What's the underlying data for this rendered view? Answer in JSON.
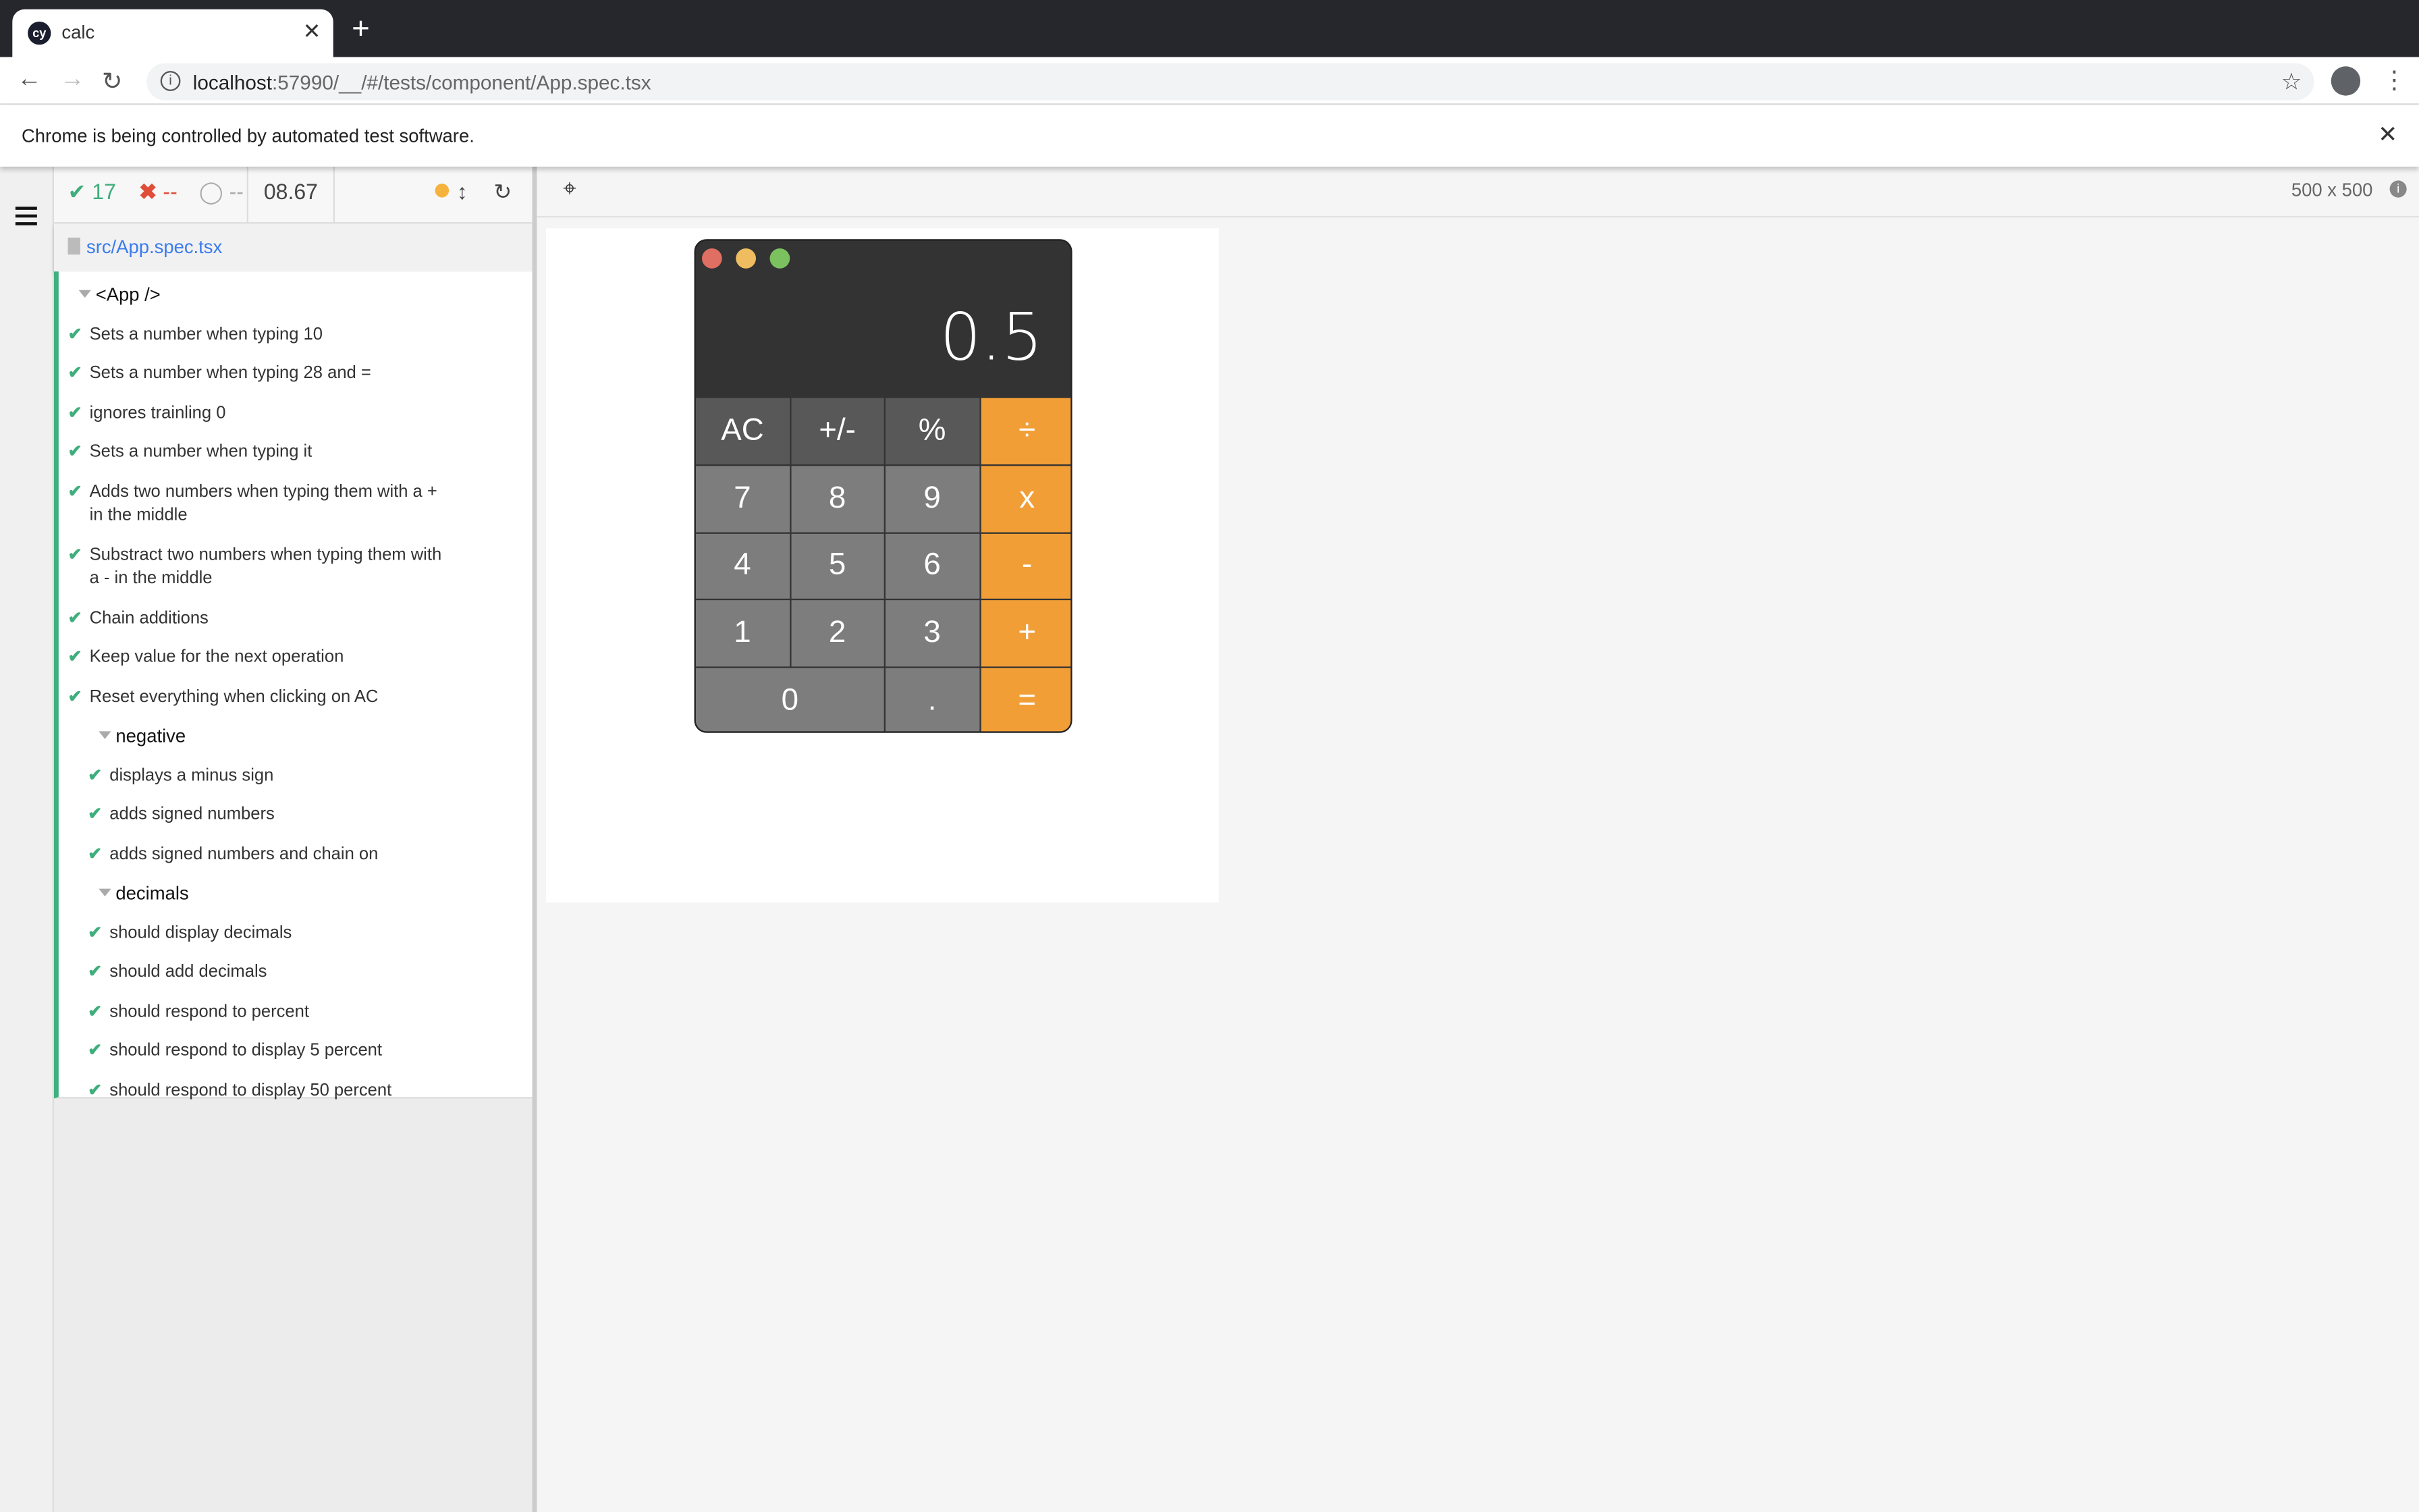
{
  "browser": {
    "tab_title": "calc",
    "favicon": "cy",
    "url_host": "localhost",
    "url_rest": ":57990/__/#/tests/component/App.spec.tsx",
    "infobar": "Chrome is being controlled by automated test software."
  },
  "reporter": {
    "passed": "17",
    "failed": "--",
    "pending": "--",
    "duration": "08.67",
    "spec_file": "src/App.spec.tsx",
    "tests": [
      {
        "type": "suite",
        "level": 0,
        "label": "<App />"
      },
      {
        "type": "test",
        "level": 1,
        "label": "Sets a number when typing 10"
      },
      {
        "type": "test",
        "level": 1,
        "label": "Sets a number when typing 28 and ="
      },
      {
        "type": "test",
        "level": 1,
        "label": "ignores trainling 0"
      },
      {
        "type": "test",
        "level": 1,
        "label": "Sets a number when typing it"
      },
      {
        "type": "test",
        "level": 1,
        "label": "Adds two numbers when typing them with a + in the middle"
      },
      {
        "type": "test",
        "level": 1,
        "label": "Substract two numbers when typing them with a - in the middle"
      },
      {
        "type": "test",
        "level": 1,
        "label": "Chain additions"
      },
      {
        "type": "test",
        "level": 1,
        "label": "Keep value for the next operation"
      },
      {
        "type": "test",
        "level": 1,
        "label": "Reset everything when clicking on AC"
      },
      {
        "type": "suite",
        "level": 1,
        "label": "negative"
      },
      {
        "type": "test",
        "level": 2,
        "label": "displays a minus sign"
      },
      {
        "type": "test",
        "level": 2,
        "label": "adds signed numbers"
      },
      {
        "type": "test",
        "level": 2,
        "label": "adds signed numbers and chain on"
      },
      {
        "type": "suite",
        "level": 1,
        "label": "decimals"
      },
      {
        "type": "test",
        "level": 2,
        "label": "should display decimals"
      },
      {
        "type": "test",
        "level": 2,
        "label": "should add decimals"
      },
      {
        "type": "test",
        "level": 2,
        "label": "should respond to percent"
      },
      {
        "type": "test",
        "level": 2,
        "label": "should respond to display 5 percent"
      },
      {
        "type": "test",
        "level": 2,
        "label": "should respond to display 50 percent"
      }
    ]
  },
  "aut": {
    "viewport": "500 x 500"
  },
  "calculator": {
    "display": "0.5",
    "keys": [
      {
        "label": "AC",
        "kind": "fn"
      },
      {
        "label": "+/-",
        "kind": "fn"
      },
      {
        "label": "%",
        "kind": "fn"
      },
      {
        "label": "÷",
        "kind": "op"
      },
      {
        "label": "7",
        "kind": "num"
      },
      {
        "label": "8",
        "kind": "num"
      },
      {
        "label": "9",
        "kind": "num"
      },
      {
        "label": "x",
        "kind": "op"
      },
      {
        "label": "4",
        "kind": "num"
      },
      {
        "label": "5",
        "kind": "num"
      },
      {
        "label": "6",
        "kind": "num"
      },
      {
        "label": "-",
        "kind": "op"
      },
      {
        "label": "1",
        "kind": "num"
      },
      {
        "label": "2",
        "kind": "num"
      },
      {
        "label": "3",
        "kind": "num"
      },
      {
        "label": "+",
        "kind": "op"
      },
      {
        "label": "0",
        "kind": "zero"
      },
      {
        "label": ".",
        "kind": "num"
      },
      {
        "label": "=",
        "kind": "op"
      }
    ]
  },
  "colors": {
    "pass": "#3fae7c",
    "fail": "#e04e39",
    "accent": "#f29e37",
    "running": "#f5b33e"
  }
}
